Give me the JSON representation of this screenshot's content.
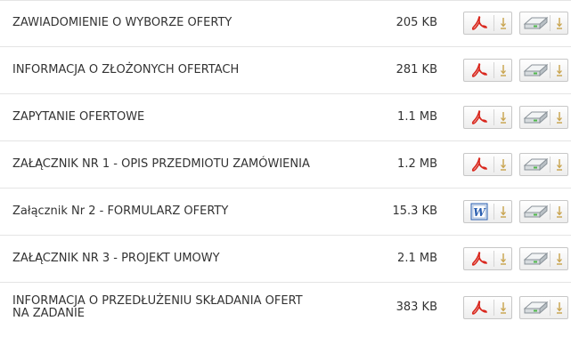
{
  "files": [
    {
      "name": "ZAWIADOMIENIE O WYBORZE OFERTY",
      "size": "205 KB",
      "type": "pdf",
      "file_icon": "pdf-icon"
    },
    {
      "name": "INFORMACJA O ZŁOŻONYCH OFERTACH",
      "size": "281 KB",
      "type": "pdf",
      "file_icon": "pdf-icon"
    },
    {
      "name": "ZAPYTANIE OFERTOWE",
      "size": "1.1 MB",
      "type": "pdf",
      "file_icon": "pdf-icon"
    },
    {
      "name": "ZAŁĄCZNIK NR 1 - OPIS PRZEDMIOTU ZAMÓWIENIA",
      "size": "1.2 MB",
      "type": "pdf",
      "file_icon": "pdf-icon"
    },
    {
      "name": "Załącznik Nr 2 - FORMULARZ OFERTY",
      "size": "15.3 KB",
      "type": "word",
      "file_icon": "word-icon"
    },
    {
      "name": "ZAŁĄCZNIK NR 3 - PROJEKT UMOWY",
      "size": "2.1 MB",
      "type": "pdf",
      "file_icon": "pdf-icon"
    },
    {
      "name": "INFORMACJA O PRZEDŁUŻENIU SKŁADANIA OFERT NA ZADANIE",
      "size": "383 KB",
      "type": "pdf",
      "file_icon": "pdf-icon"
    }
  ],
  "icons": {
    "download": "download-arrow-icon",
    "save": "hard-drive-icon"
  },
  "colors": {
    "pdf": "#d9261c",
    "word": "#2b5fb0",
    "arrow": "#c8a24a",
    "drive": "#8a9299",
    "drive_light": "#4fb84a"
  }
}
